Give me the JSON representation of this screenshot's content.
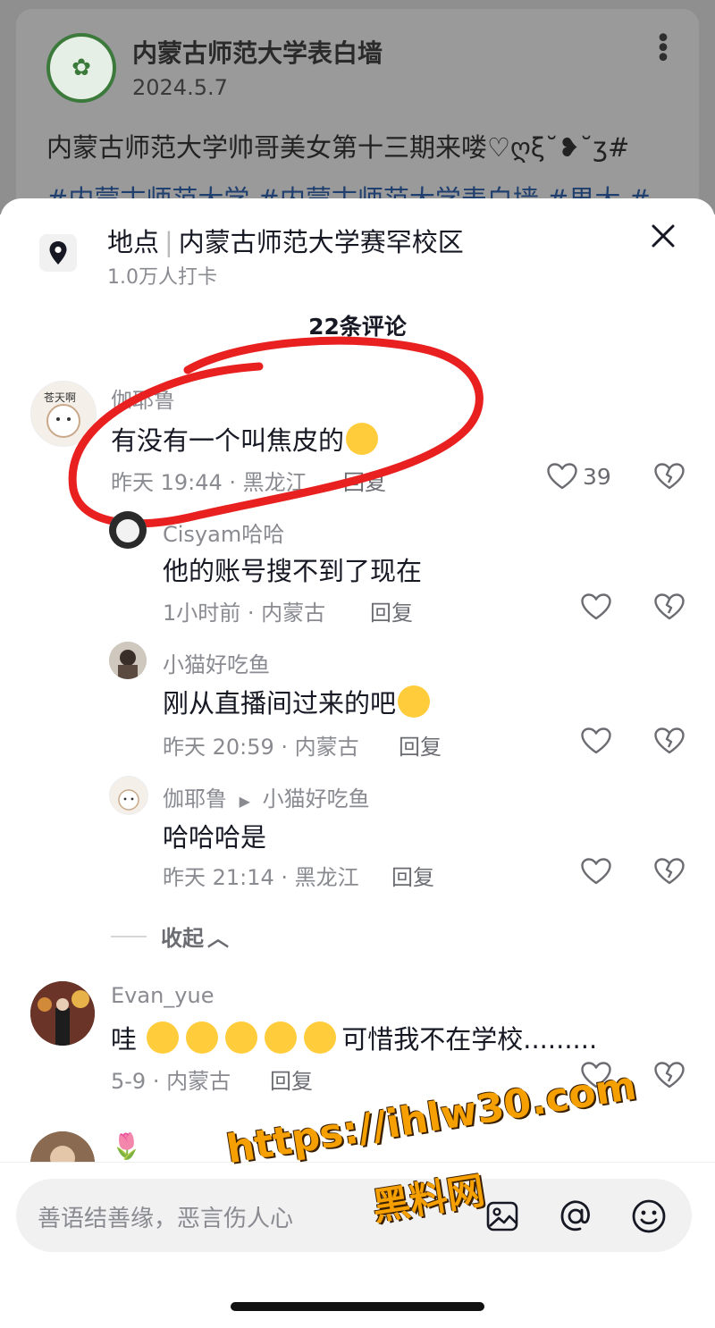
{
  "post": {
    "account_name": "内蒙古师范大学表白墙",
    "date": "2024.5.7",
    "text": "内蒙古师范大学帅哥美女第十三期来喽♡ღξ˘❥˘ʒ#",
    "hashtags": "内蒙古师范大学 #内蒙古师范大学表白墙 #男大 #"
  },
  "location": {
    "label": "地点",
    "name": "内蒙古师范大学赛罕校区",
    "checkins": "1.0万人打卡"
  },
  "comments_count": "22条评论",
  "comments": [
    {
      "user": "伽耶鲁",
      "text": "有没有一个叫焦皮的",
      "time": "昨天 19:44 · 黑龙江",
      "reply": "回复",
      "likes": "39"
    },
    {
      "user": "Cisyam哈哈",
      "text": "他的账号搜不到了现在",
      "time": "1小时前 · 内蒙古",
      "reply": "回复",
      "likes": ""
    },
    {
      "user": "小猫好吃鱼",
      "text": "刚从直播间过来的吧",
      "time": "昨天 20:59 · 内蒙古",
      "reply": "回复",
      "likes": ""
    },
    {
      "user": "伽耶鲁",
      "reply_to": "小猫好吃鱼",
      "text": "哈哈哈是",
      "time": "昨天 21:14 · 黑龙江",
      "reply": "回复",
      "likes": ""
    },
    {
      "user": "Evan_yue",
      "text": "哇",
      "text_suffix": "可惜我不在学校.........",
      "time": "5-9 · 内蒙古",
      "reply": "回复",
      "likes": ""
    },
    {
      "user": "",
      "text": "🌷"
    }
  ],
  "collapse_label": "收起",
  "input": {
    "placeholder": "善语结善缘，恶言伤人心"
  },
  "watermark": {
    "line1": "https://ihlw30.com",
    "line2": "黑料网"
  },
  "colors": {
    "accent_red": "#e8201f",
    "primary_text": "#161823",
    "secondary_text": "#8a8b91",
    "watermark": "#f5a000"
  },
  "icons": [
    "location-pin-icon",
    "close-icon",
    "heart-icon",
    "broken-heart-icon",
    "image-icon",
    "at-icon",
    "emoji-icon",
    "more-icon"
  ]
}
